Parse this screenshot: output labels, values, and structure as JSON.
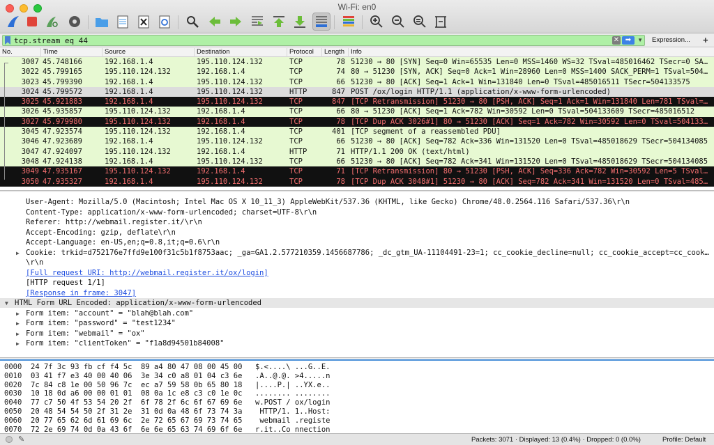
{
  "window": {
    "title": "Wi-Fi: en0"
  },
  "toolbar": {
    "icons": [
      "shark-fin-start-icon",
      "stop-capture-icon",
      "restart-capture-icon",
      "capture-options-icon",
      "open-folder-icon",
      "save-file-icon",
      "close-file-icon",
      "reload-file-icon",
      "find-packet-icon",
      "go-back-icon",
      "go-forward-icon",
      "go-to-packet-icon",
      "go-first-icon",
      "go-last-icon",
      "autoscroll-icon",
      "colorize-icon",
      "zoom-in-icon",
      "zoom-out-icon",
      "zoom-normal-icon",
      "resize-columns-icon"
    ]
  },
  "filter": {
    "value": "tcp.stream eq 44",
    "clear_label": "✕",
    "apply_label": "➡",
    "expression_label": "Expression...",
    "add_label": "+"
  },
  "packet_list": {
    "columns": [
      "No.",
      "Time",
      "Source",
      "Destination",
      "Protocol",
      "Length",
      "Info"
    ],
    "rows": [
      {
        "no": "3007",
        "time": "45.748166",
        "src": "192.168.1.4",
        "dst": "195.110.124.132",
        "proto": "TCP",
        "len": "78",
        "info": "51230 → 80 [SYN] Seq=0 Win=65535 Len=0 MSS=1460 WS=32 TSval=485016462 TSecr=0 SA…",
        "style": "tcp"
      },
      {
        "no": "3022",
        "time": "45.799165",
        "src": "195.110.124.132",
        "dst": "192.168.1.4",
        "proto": "TCP",
        "len": "74",
        "info": "80 → 51230 [SYN, ACK] Seq=0 Ack=1 Win=28960 Len=0 MSS=1400 SACK_PERM=1 TSval=504…",
        "style": "tcp"
      },
      {
        "no": "3023",
        "time": "45.799390",
        "src": "192.168.1.4",
        "dst": "195.110.124.132",
        "proto": "TCP",
        "len": "66",
        "info": "51230 → 80 [ACK] Seq=1 Ack=1 Win=131840 Len=0 TSval=485016511 TSecr=504133575",
        "style": "tcp"
      },
      {
        "no": "3024",
        "time": "45.799572",
        "src": "192.168.1.4",
        "dst": "195.110.124.132",
        "proto": "HTTP",
        "len": "847",
        "info": "POST /ox/login HTTP/1.1  (application/x-www-form-urlencoded)",
        "style": "http"
      },
      {
        "no": "3025",
        "time": "45.921883",
        "src": "192.168.1.4",
        "dst": "195.110.124.132",
        "proto": "TCP",
        "len": "847",
        "info": "[TCP Retransmission] 51230 → 80 [PSH, ACK] Seq=1 Ack=1 Win=131840 Len=781 TSval=…",
        "style": "bad"
      },
      {
        "no": "3026",
        "time": "45.935857",
        "src": "195.110.124.132",
        "dst": "192.168.1.4",
        "proto": "TCP",
        "len": "66",
        "info": "80 → 51230 [ACK] Seq=1 Ack=782 Win=30592 Len=0 TSval=504133609 TSecr=485016512",
        "style": "tcp"
      },
      {
        "no": "3027",
        "time": "45.979980",
        "src": "195.110.124.132",
        "dst": "192.168.1.4",
        "proto": "TCP",
        "len": "78",
        "info": "[TCP Dup ACK 3026#1] 80 → 51230 [ACK] Seq=1 Ack=782 Win=30592 Len=0 TSval=504133…",
        "style": "bad"
      },
      {
        "no": "3045",
        "time": "47.923574",
        "src": "195.110.124.132",
        "dst": "192.168.1.4",
        "proto": "TCP",
        "len": "401",
        "info": "[TCP segment of a reassembled PDU]",
        "style": "tcp"
      },
      {
        "no": "3046",
        "time": "47.923689",
        "src": "192.168.1.4",
        "dst": "195.110.124.132",
        "proto": "TCP",
        "len": "66",
        "info": "51230 → 80 [ACK] Seq=782 Ack=336 Win=131520 Len=0 TSval=485018629 TSecr=504134085",
        "style": "tcp"
      },
      {
        "no": "3047",
        "time": "47.924097",
        "src": "195.110.124.132",
        "dst": "192.168.1.4",
        "proto": "HTTP",
        "len": "71",
        "info": "HTTP/1.1 200 OK  (text/html)",
        "style": "tcp"
      },
      {
        "no": "3048",
        "time": "47.924138",
        "src": "192.168.1.4",
        "dst": "195.110.124.132",
        "proto": "TCP",
        "len": "66",
        "info": "51230 → 80 [ACK] Seq=782 Ack=341 Win=131520 Len=0 TSval=485018629 TSecr=504134085",
        "style": "tcp"
      },
      {
        "no": "3049",
        "time": "47.935167",
        "src": "195.110.124.132",
        "dst": "192.168.1.4",
        "proto": "TCP",
        "len": "71",
        "info": "[TCP Retransmission] 80 → 51230 [PSH, ACK] Seq=336 Ack=782 Win=30592 Len=5 TSval…",
        "style": "bad"
      },
      {
        "no": "3050",
        "time": "47.935327",
        "src": "192.168.1.4",
        "dst": "195.110.124.132",
        "proto": "TCP",
        "len": "78",
        "info": "[TCP Dup ACK 3048#1] 51230 → 80 [ACK] Seq=782 Ack=341 Win=131520 Len=0 TSval=485…",
        "style": "bad"
      }
    ]
  },
  "details": {
    "lines": [
      {
        "text": "User-Agent: Mozilla/5.0 (Macintosh; Intel Mac OS X 10_11_3) AppleWebKit/537.36 (KHTML, like Gecko) Chrome/48.0.2564.116 Safari/537.36\\r\\n",
        "indent": 1,
        "arrow": false,
        "link": false
      },
      {
        "text": "Content-Type: application/x-www-form-urlencoded; charset=UTF-8\\r\\n",
        "indent": 1,
        "arrow": false,
        "link": false
      },
      {
        "text": "Referer: http://webmail.register.it/\\r\\n",
        "indent": 1,
        "arrow": false,
        "link": false
      },
      {
        "text": "Accept-Encoding: gzip, deflate\\r\\n",
        "indent": 1,
        "arrow": false,
        "link": false
      },
      {
        "text": "Accept-Language: en-US,en;q=0.8,it;q=0.6\\r\\n",
        "indent": 1,
        "arrow": false,
        "link": false
      },
      {
        "text": "Cookie: trkid=d752176e7ffd9e100f31c5b1f8753aac; _ga=GA1.2.577210359.1456687786; _dc_gtm_UA-11104491-23=1; cc_cookie_decline=null; cc_cookie_accept=cc_cook…",
        "indent": 1,
        "arrow": true,
        "link": false
      },
      {
        "text": "\\r\\n",
        "indent": 1,
        "arrow": false,
        "link": false
      },
      {
        "text": "[Full request URI: http://webmail.register.it/ox/login]",
        "indent": 1,
        "arrow": false,
        "link": true
      },
      {
        "text": "[HTTP request 1/1]",
        "indent": 1,
        "arrow": false,
        "link": false
      },
      {
        "text": "[Response in frame: 3047]",
        "indent": 1,
        "arrow": false,
        "link": true
      },
      {
        "text": "HTML Form URL Encoded: application/x-www-form-urlencoded",
        "indent": 0,
        "arrow": "open",
        "link": false,
        "hl": true
      },
      {
        "text": "Form item: \"account\" = \"blah@blah.com\"",
        "indent": 1,
        "arrow": true,
        "link": false
      },
      {
        "text": "Form item: \"password\" = \"test1234\"",
        "indent": 1,
        "arrow": true,
        "link": false
      },
      {
        "text": "Form item: \"webmail\" = \"ox\"",
        "indent": 1,
        "arrow": true,
        "link": false
      },
      {
        "text": "Form item: \"clientToken\" = \"f1a8d94501b84008\"",
        "indent": 1,
        "arrow": true,
        "link": false
      }
    ]
  },
  "hex": {
    "rows": [
      {
        "off": "0000",
        "bytes": "24 7f 3c 93 fb cf f4 5c  89 a4 80 47 08 00 45 00",
        "ascii": "$.<....\\ ...G..E."
      },
      {
        "off": "0010",
        "bytes": "03 41 f7 e3 40 00 40 06  3e 34 c0 a8 01 04 c3 6e",
        "ascii": ".A..@.@. >4.....n"
      },
      {
        "off": "0020",
        "bytes": "7c 84 c8 1e 00 50 96 7c  ec a7 59 58 0b 65 80 18",
        "ascii": "|....P.| ..YX.e.."
      },
      {
        "off": "0030",
        "bytes": "10 18 0d a6 00 00 01 01  08 0a 1c e8 c3 c0 1e 0c",
        "ascii": "........ ........"
      },
      {
        "off": "0040",
        "bytes": "77 c7 50 4f 53 54 20 2f  6f 78 2f 6c 6f 67 69 6e",
        "ascii": "w.POST / ox/login"
      },
      {
        "off": "0050",
        "bytes": "20 48 54 54 50 2f 31 2e  31 0d 0a 48 6f 73 74 3a",
        "ascii": " HTTP/1. 1..Host:"
      },
      {
        "off": "0060",
        "bytes": "20 77 65 62 6d 61 69 6c  2e 72 65 67 69 73 74 65",
        "ascii": " webmail .registe"
      },
      {
        "off": "0070",
        "bytes": "72 2e 69 74 0d 0a 43 6f  6e 6e 65 63 74 69 6f 6e",
        "ascii": "r.it..Co nnection"
      }
    ]
  },
  "status": {
    "packets": "Packets: 3071 · Displayed: 13 (0.4%) · Dropped: 0 (0.0%)",
    "profile": "Profile: Default"
  },
  "colors": {
    "tcp_row": "#e7f9d2",
    "http_row": "#dcdcdc",
    "bad_row": "#111111",
    "bad_text": "#f46f6f",
    "filter_ok": "#aff0a6"
  }
}
